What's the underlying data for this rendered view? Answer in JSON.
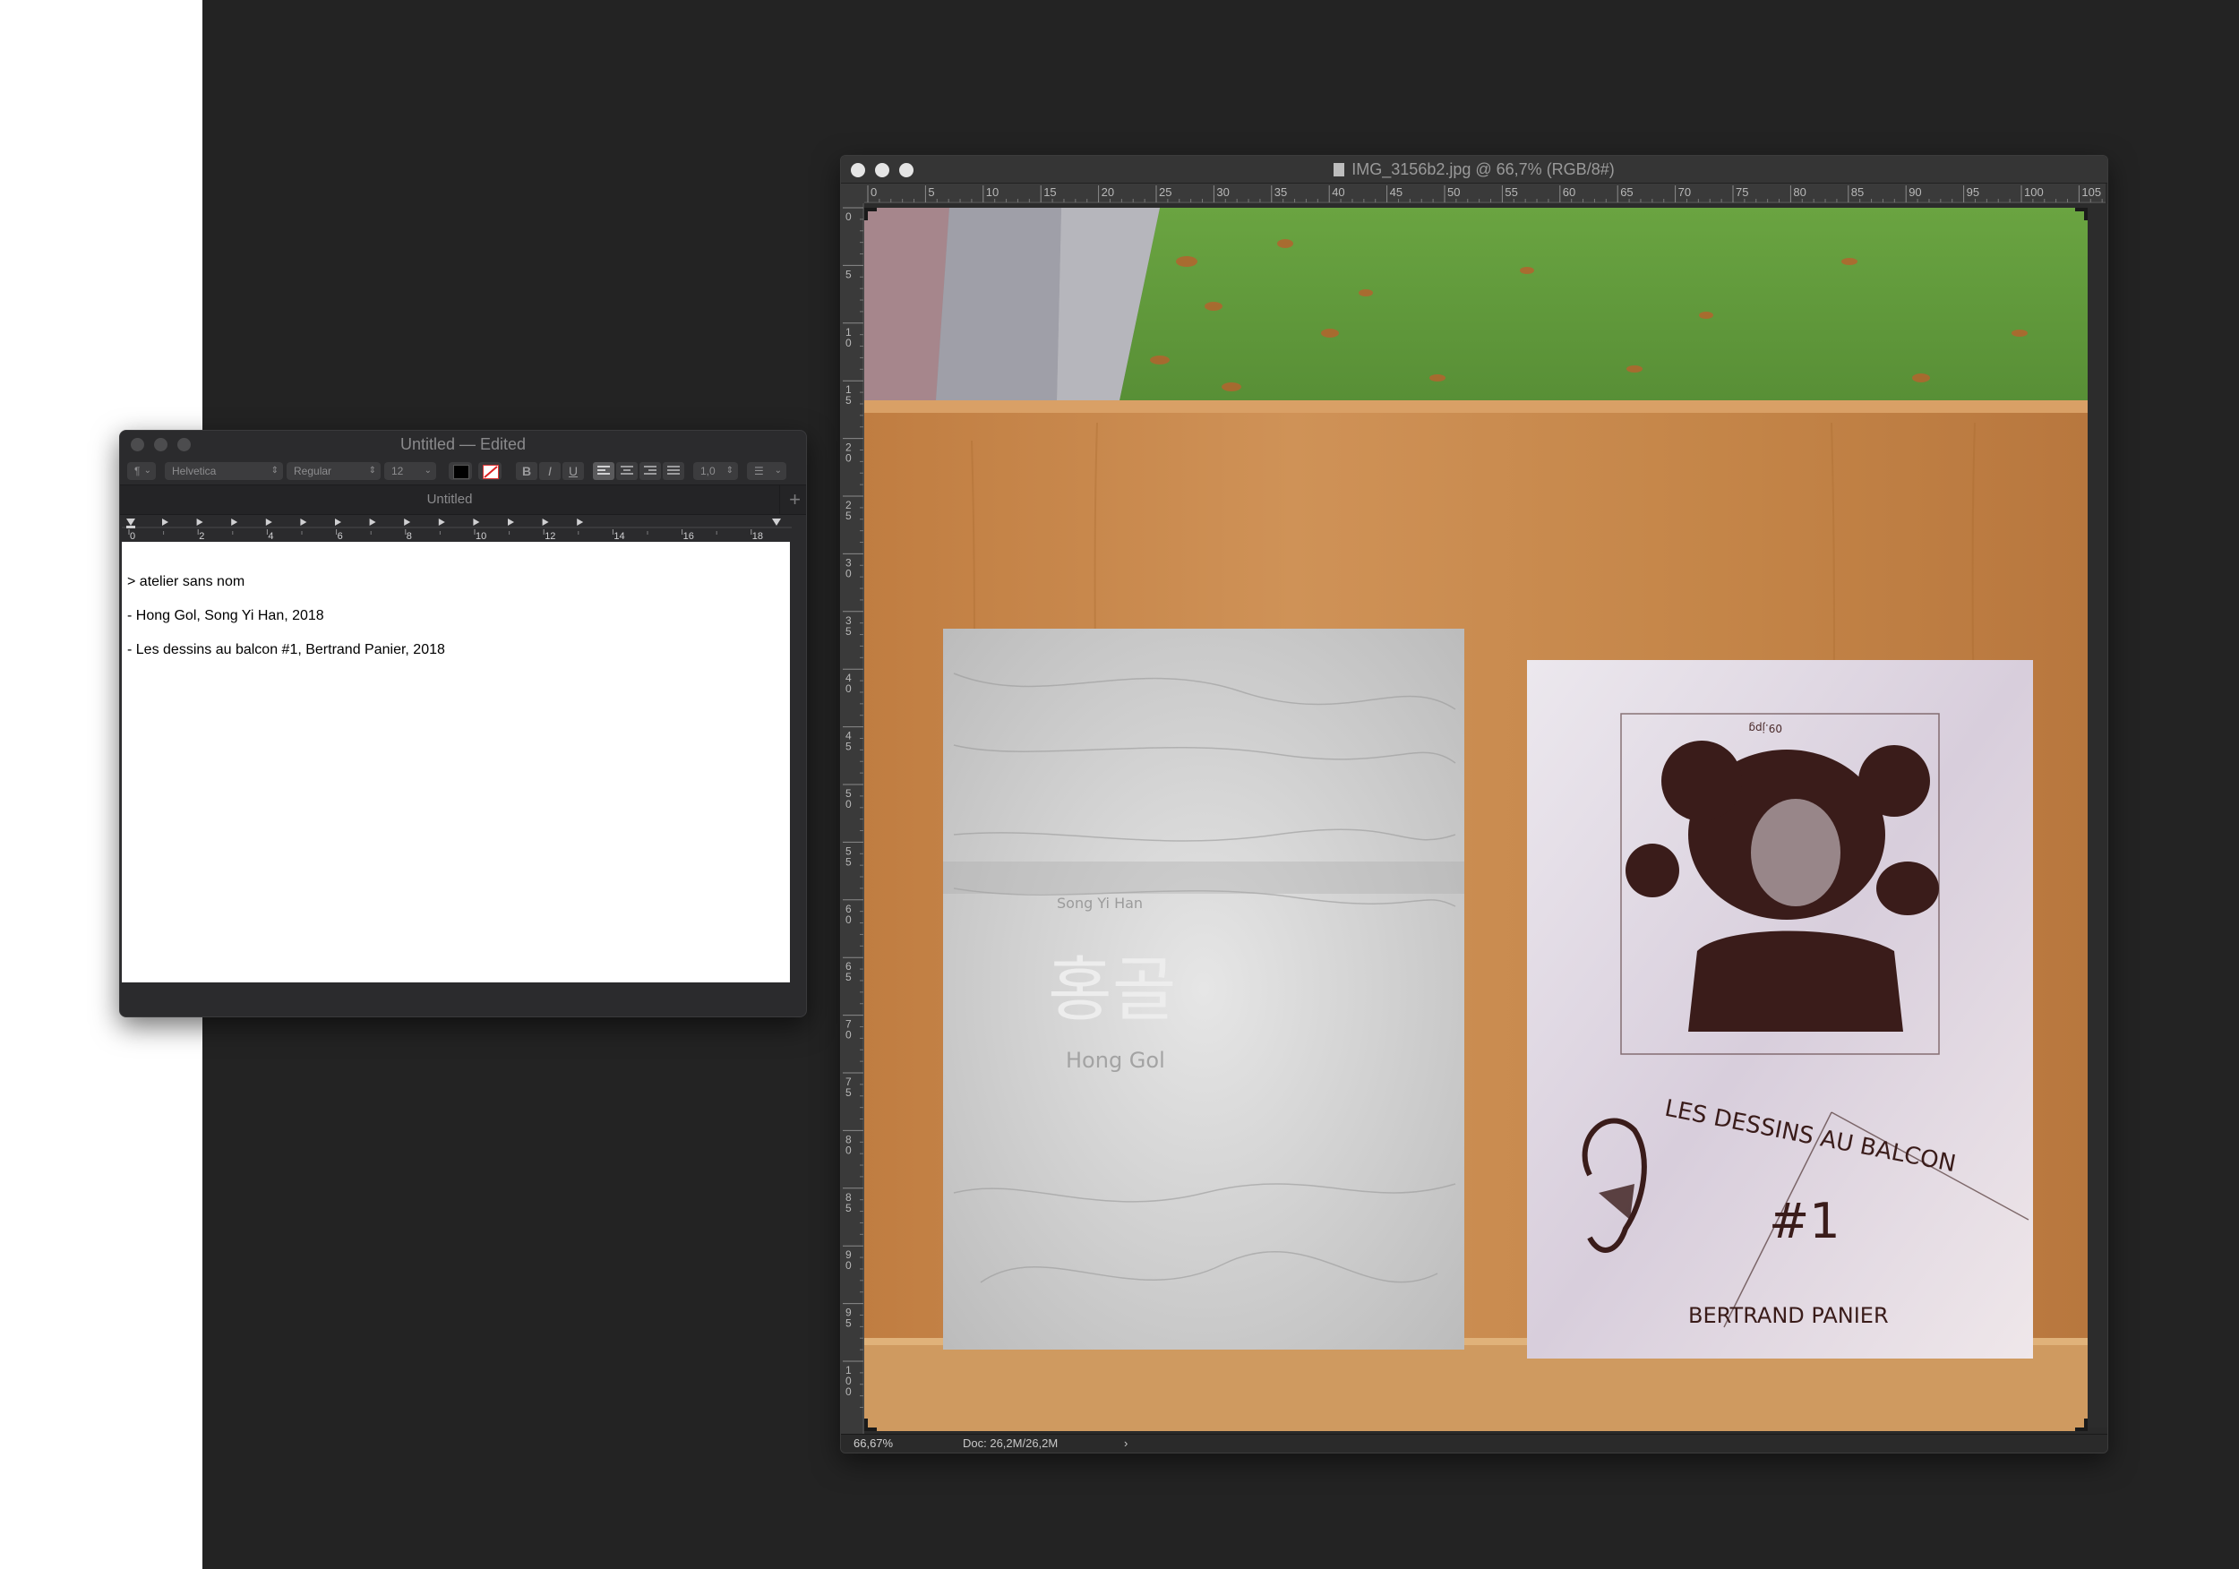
{
  "textedit": {
    "title": "Untitled — Edited",
    "tab_title": "Untitled",
    "toolbar": {
      "paragraph_style": "¶",
      "font_family": "Helvetica",
      "font_typeface": "Regular",
      "font_size": "12",
      "bold": "B",
      "italic": "I",
      "underline": "U",
      "line_spacing": "1,0",
      "list": "☰"
    },
    "ruler_labels": [
      "0",
      "2",
      "4",
      "6",
      "8",
      "10",
      "12",
      "14",
      "16",
      "18"
    ],
    "lines": [
      "> atelier sans nom",
      "- Hong Gol, Song Yi Han, 2018",
      "- Les dessins au balcon #1, Bertrand Panier, 2018"
    ]
  },
  "viewer": {
    "title": "IMG_3156b2.jpg @ 66,7% (RGB/8#)",
    "h_ruler_labels": [
      "0",
      "5",
      "10",
      "15",
      "20",
      "25",
      "30",
      "35",
      "40",
      "45",
      "50",
      "55",
      "60",
      "65",
      "70",
      "75",
      "80",
      "85",
      "90",
      "95",
      "100",
      "105"
    ],
    "v_ruler_labels": [
      "0",
      "5",
      "10",
      "15",
      "20",
      "25",
      "30",
      "35",
      "40",
      "45",
      "50",
      "55",
      "60",
      "65",
      "70",
      "75",
      "80",
      "85",
      "90",
      "95",
      "100"
    ],
    "zoom": "66,67%",
    "doc_size": "Doc: 26,2M/26,2M",
    "status_arrow": "›",
    "book_left": {
      "author": "Song Yi Han",
      "title_korean": "홍골",
      "title_latin": "Hong Gol"
    },
    "book_right": {
      "top_label": "09.jpg",
      "title": "LES DESSINS AU BALCON",
      "number": "#1",
      "author": "BERTRAND PANIER"
    }
  },
  "colors": {
    "desktop": "#232323",
    "wood": "#c98a4e",
    "grass": "#5f9a3a"
  }
}
